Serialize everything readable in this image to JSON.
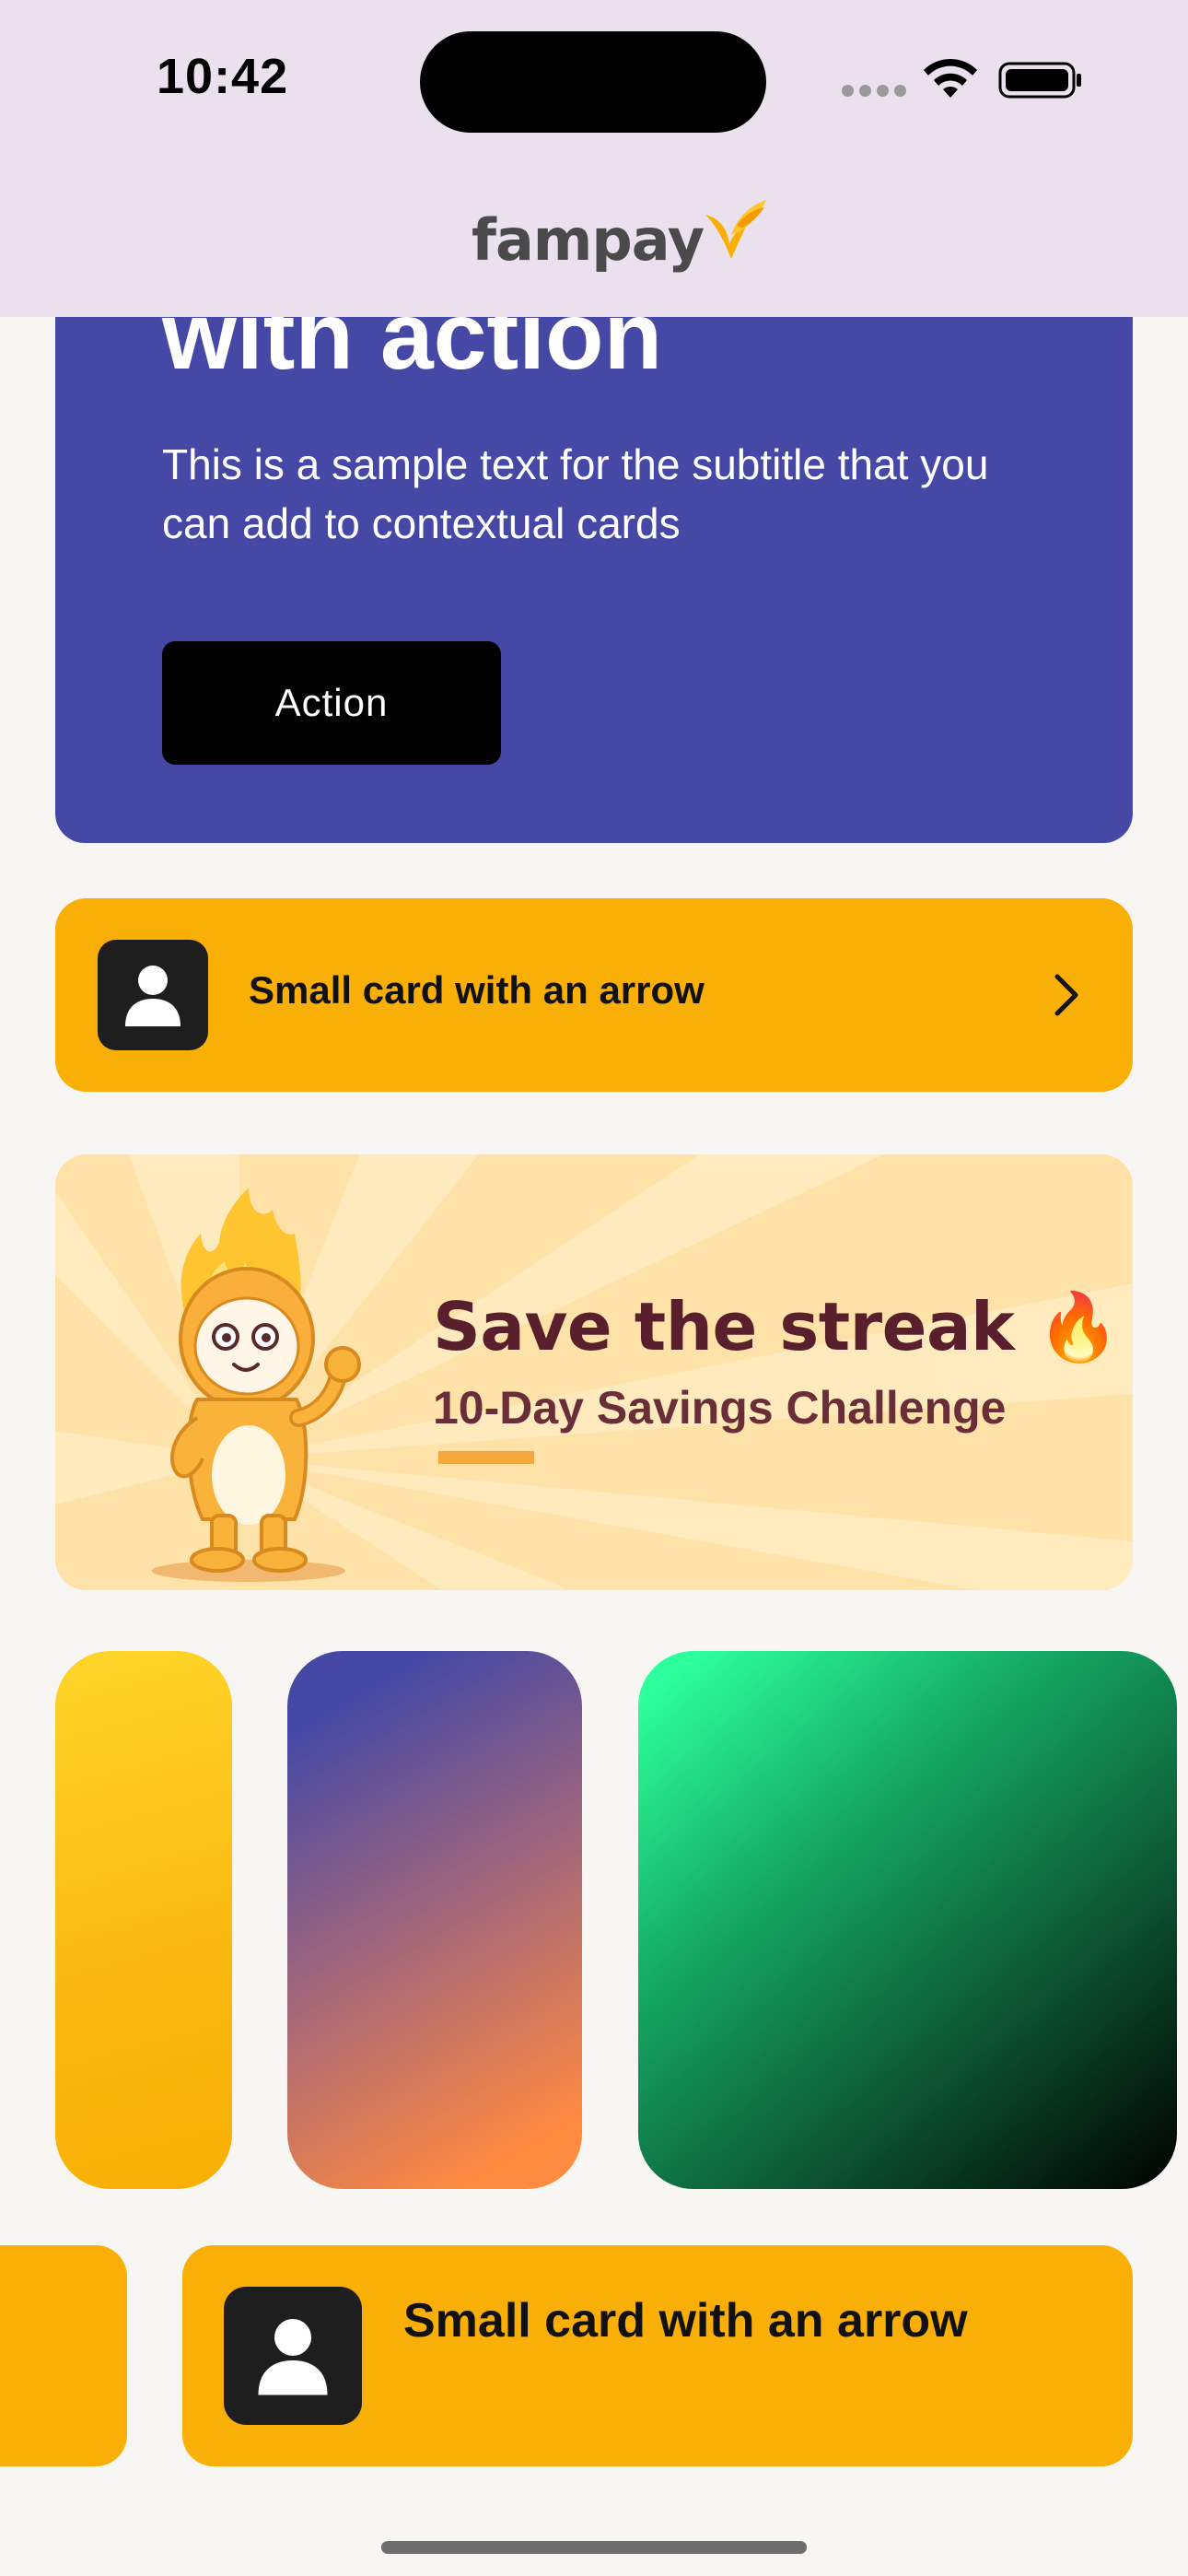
{
  "status_bar": {
    "time": "10:42"
  },
  "header": {
    "logo_text": "fampay",
    "logo_icon": "fampay-bird-logo"
  },
  "big_card": {
    "title": "with action",
    "subtitle": "This is a sample text for the subtitle that you can add to contextual cards",
    "action_label": "Action",
    "background_color": "#4549A5"
  },
  "small_card": {
    "label": "Small card with an arrow",
    "icon": "user-avatar-icon",
    "trailing_icon": "chevron-right-icon",
    "background_color": "#F9AF05"
  },
  "banner": {
    "title": "Save the streak 🔥",
    "subtitle": "10-Day Savings Challenge",
    "illustration": "flame-mascot"
  },
  "gradient_tiles": [
    {
      "name": "yellow-gradient-tile",
      "colors": [
        "#FFD52A",
        "#F9AF05"
      ]
    },
    {
      "name": "purple-orange-gradient-tile",
      "colors": [
        "#4549A5",
        "#FF8A40"
      ]
    },
    {
      "name": "green-black-gradient-tile",
      "colors": [
        "#2DFF9C",
        "#000000"
      ]
    }
  ],
  "bottom_card": {
    "label": "Small card with an arrow",
    "icon": "user-avatar-icon"
  }
}
